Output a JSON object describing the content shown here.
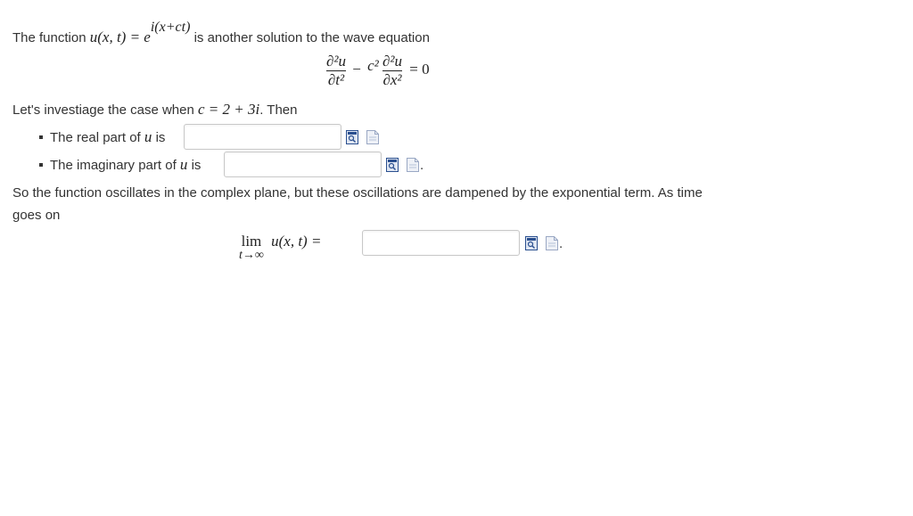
{
  "intro": {
    "prefix": "The function",
    "func": "u(x, t) = ",
    "base": "e",
    "exponent": "i(x+ct)",
    "suffix": "is another solution to the wave equation"
  },
  "equation": {
    "term1_num": "∂²u",
    "term1_den": "∂t²",
    "minus": "−",
    "c2": "c²",
    "term2_num": "∂²u",
    "term2_den": "∂x²",
    "rhs": "= 0"
  },
  "case_line": {
    "text": "Let's investiage the case when",
    "math": "c = 2 + 3i",
    "then": ".  Then"
  },
  "items": [
    {
      "label_pre": "The real part of",
      "var": "u",
      "label_post": "is",
      "value": ""
    },
    {
      "label_pre": "The imaginary part of",
      "var": "u",
      "label_post": "is",
      "value": ""
    }
  ],
  "paragraph": {
    "line1": "So the function oscillates in the complex plane, but these oscillations are dampened by the exponential term. As time",
    "line2": "goes on"
  },
  "limit": {
    "lim": "lim",
    "sub": "t→∞",
    "expr": "u(x, t) =",
    "value": ""
  },
  "icons": {
    "preview": "preview-icon",
    "help": "help-document-icon",
    "accent": "#2a4f8f"
  }
}
